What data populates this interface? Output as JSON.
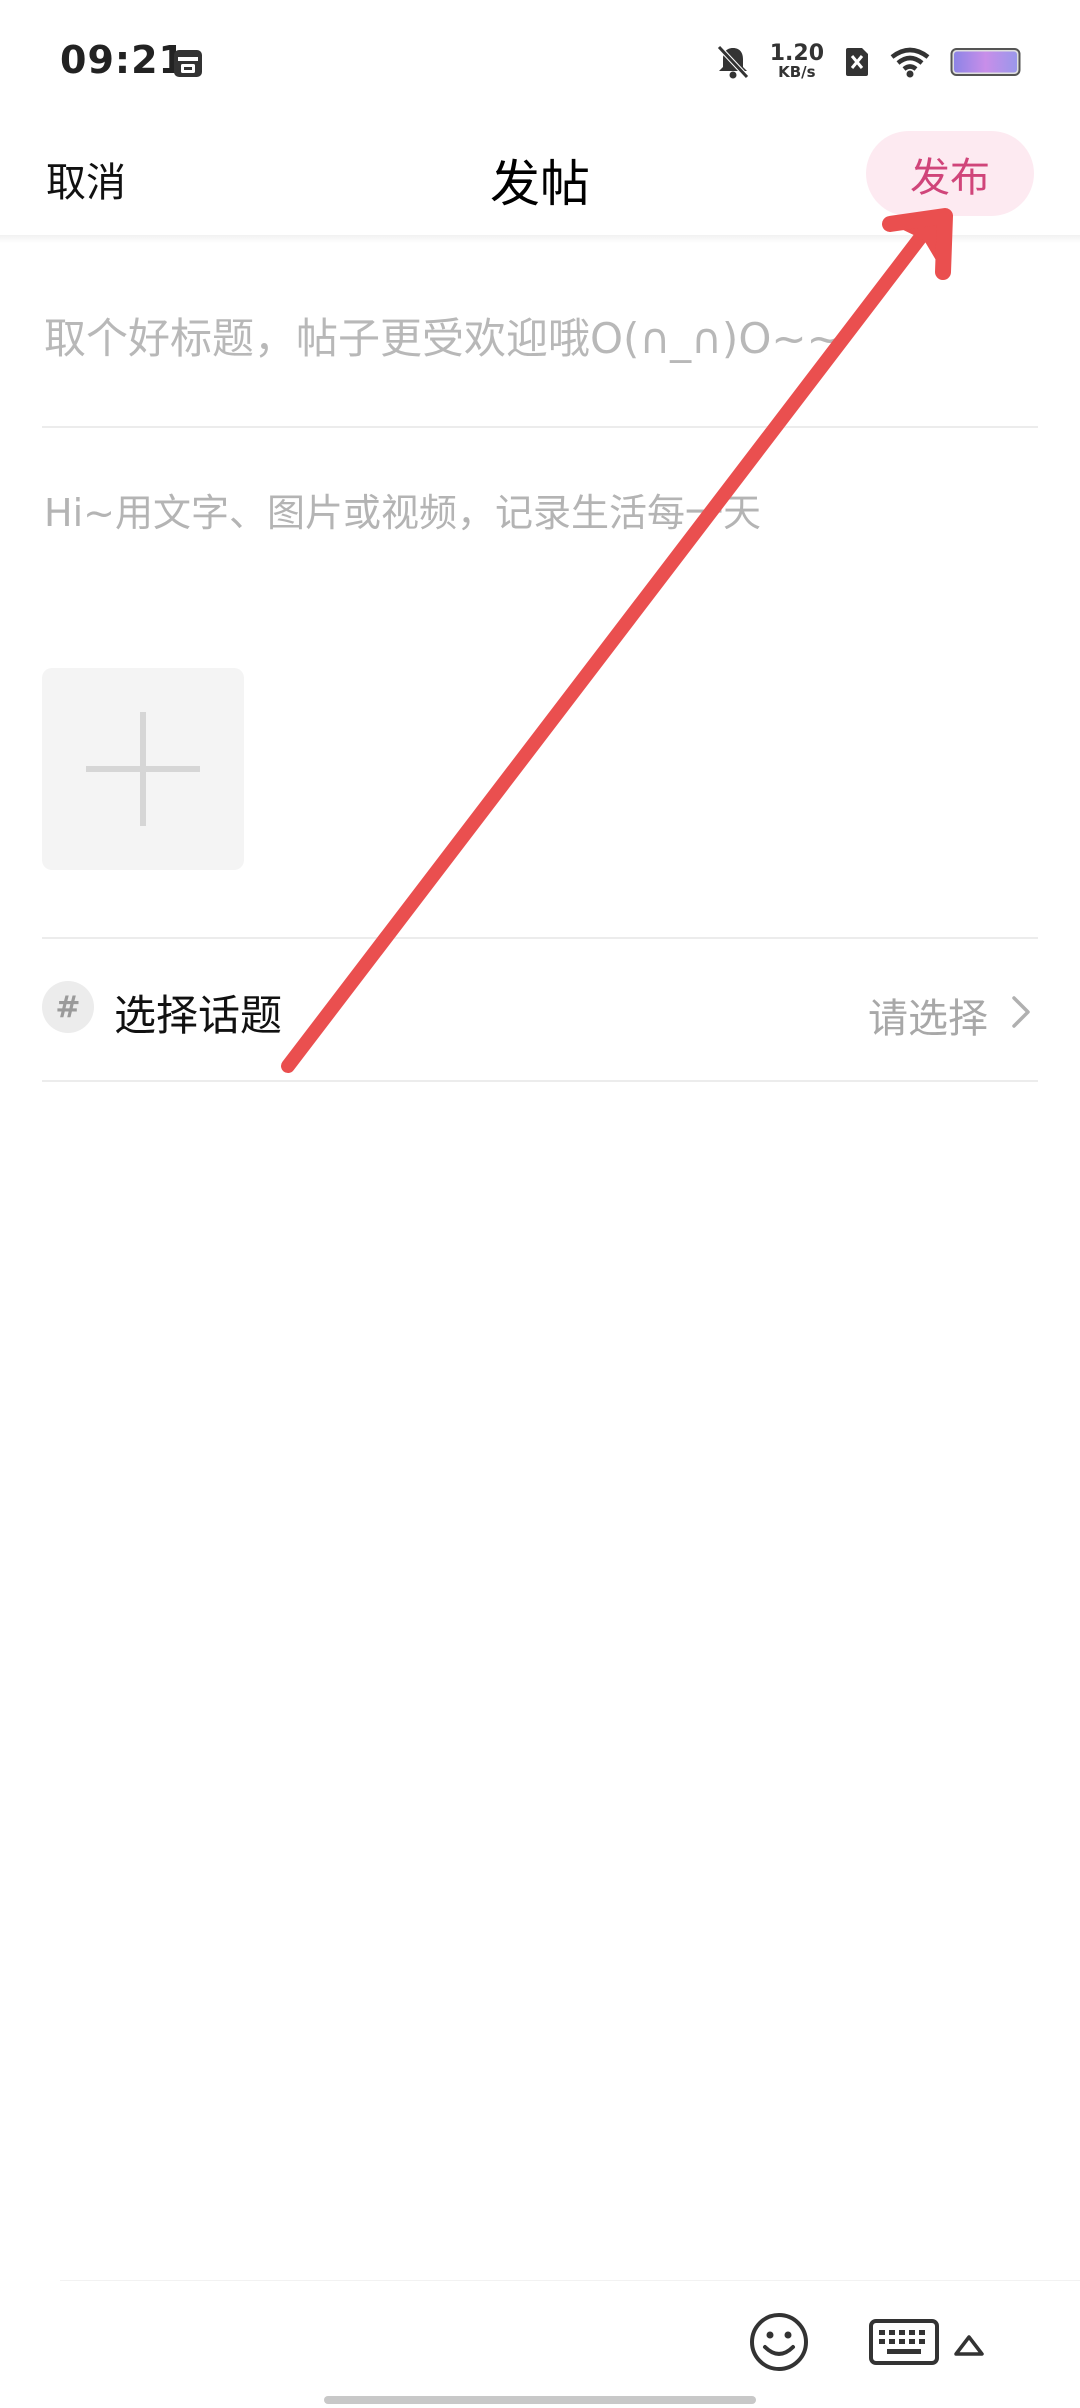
{
  "status_bar": {
    "time": "09:21",
    "net_speed_value": "1.20",
    "net_speed_unit": "KB/s",
    "icons": [
      "calendar-icon",
      "bell-muted-icon",
      "sim-disabled-icon",
      "wifi-icon",
      "battery-icon"
    ]
  },
  "nav": {
    "cancel_label": "取消",
    "title": "发帖",
    "publish_label": "发布"
  },
  "compose": {
    "title_placeholder": "取个好标题，帖子更受欢迎哦O(∩_∩)O~~",
    "body_placeholder": "Hi~用文字、图片或视频，记录生活每一天",
    "add_media_icon": "plus-icon"
  },
  "topic": {
    "icon_glyph": "#",
    "label": "选择话题",
    "value": "请选择"
  },
  "toolbar": {
    "icons": [
      "emoji-icon",
      "keyboard-icon",
      "expand-up-icon"
    ]
  },
  "colors": {
    "accent": "#d0457a",
    "publish_bg": "#fdeaf1",
    "placeholder": "#b8b8b8",
    "annotation_arrow": "#ea4f4f"
  }
}
